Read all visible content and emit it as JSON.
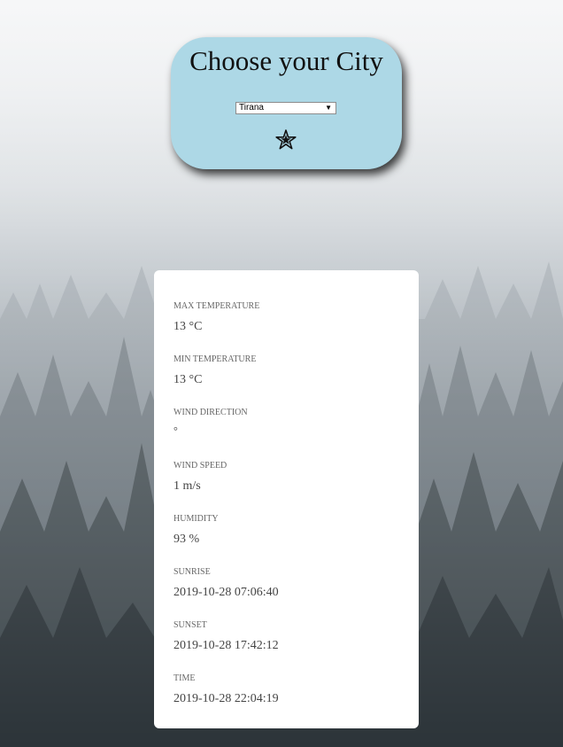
{
  "city_card": {
    "title": "Choose your City",
    "select": {
      "selected": "Tirana",
      "arrow": "▼"
    },
    "star_icon": "star-icon"
  },
  "weather": {
    "metrics": [
      {
        "label": "MAX TEMPERATURE",
        "value": "13 °C"
      },
      {
        "label": "MIN TEMPERATURE",
        "value": "13 °C"
      },
      {
        "label": "WIND DIRECTION",
        "value": "°"
      },
      {
        "label": "WIND SPEED",
        "value": "1 m/s"
      },
      {
        "label": "HUMIDITY",
        "value": "93 %"
      },
      {
        "label": "SUNRISE",
        "value": "2019-10-28 07:06:40"
      },
      {
        "label": "SUNSET",
        "value": "2019-10-28 17:42:12"
      },
      {
        "label": "TIME",
        "value": "2019-10-28 22:04:19"
      }
    ]
  },
  "colors": {
    "card_blue": "#add8e6",
    "panel_white": "#ffffff"
  }
}
